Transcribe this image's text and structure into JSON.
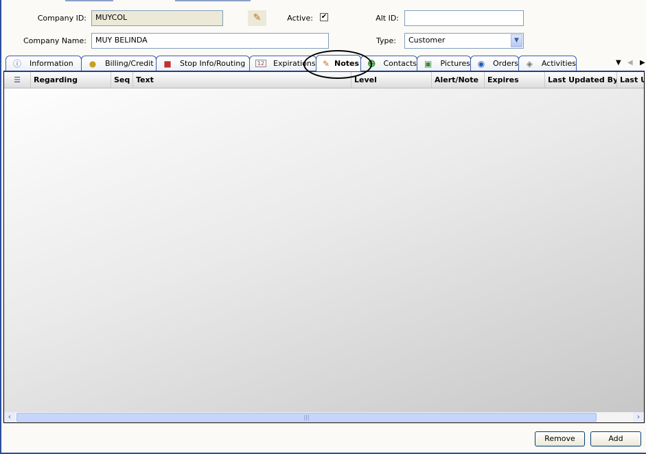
{
  "form": {
    "company_id_label": "Company ID:",
    "company_id_value": "MUYCOL",
    "active_label": "Active:",
    "active_checked": true,
    "alt_id_label": "Alt ID:",
    "alt_id_value": "",
    "company_name_label": "Company Name:",
    "company_name_value": "MUY BELINDA",
    "type_label": "Type:",
    "type_value": "Customer"
  },
  "tabs": [
    {
      "label": "Information",
      "icon": "info-icon"
    },
    {
      "label": "Billing/Credit",
      "icon": "money-bag-icon"
    },
    {
      "label": "Stop Info/Routing",
      "icon": "truck-icon"
    },
    {
      "label": "Expirations",
      "icon": "calendar-icon"
    },
    {
      "label": "Notes",
      "icon": "pencil-icon",
      "active": true
    },
    {
      "label": "Contacts",
      "icon": "people-icon"
    },
    {
      "label": "Pictures",
      "icon": "picture-icon"
    },
    {
      "label": "Orders",
      "icon": "box-icon"
    },
    {
      "label": "Activities",
      "icon": "activity-icon"
    }
  ],
  "grid": {
    "columns": [
      "Regarding",
      "Seq",
      "Text",
      "Level",
      "Alert/Note",
      "Expires",
      "Last Updated By",
      "Last U"
    ],
    "rows": []
  },
  "buttons": {
    "remove": "Remove",
    "add": "Add"
  },
  "calendar_day": "12"
}
